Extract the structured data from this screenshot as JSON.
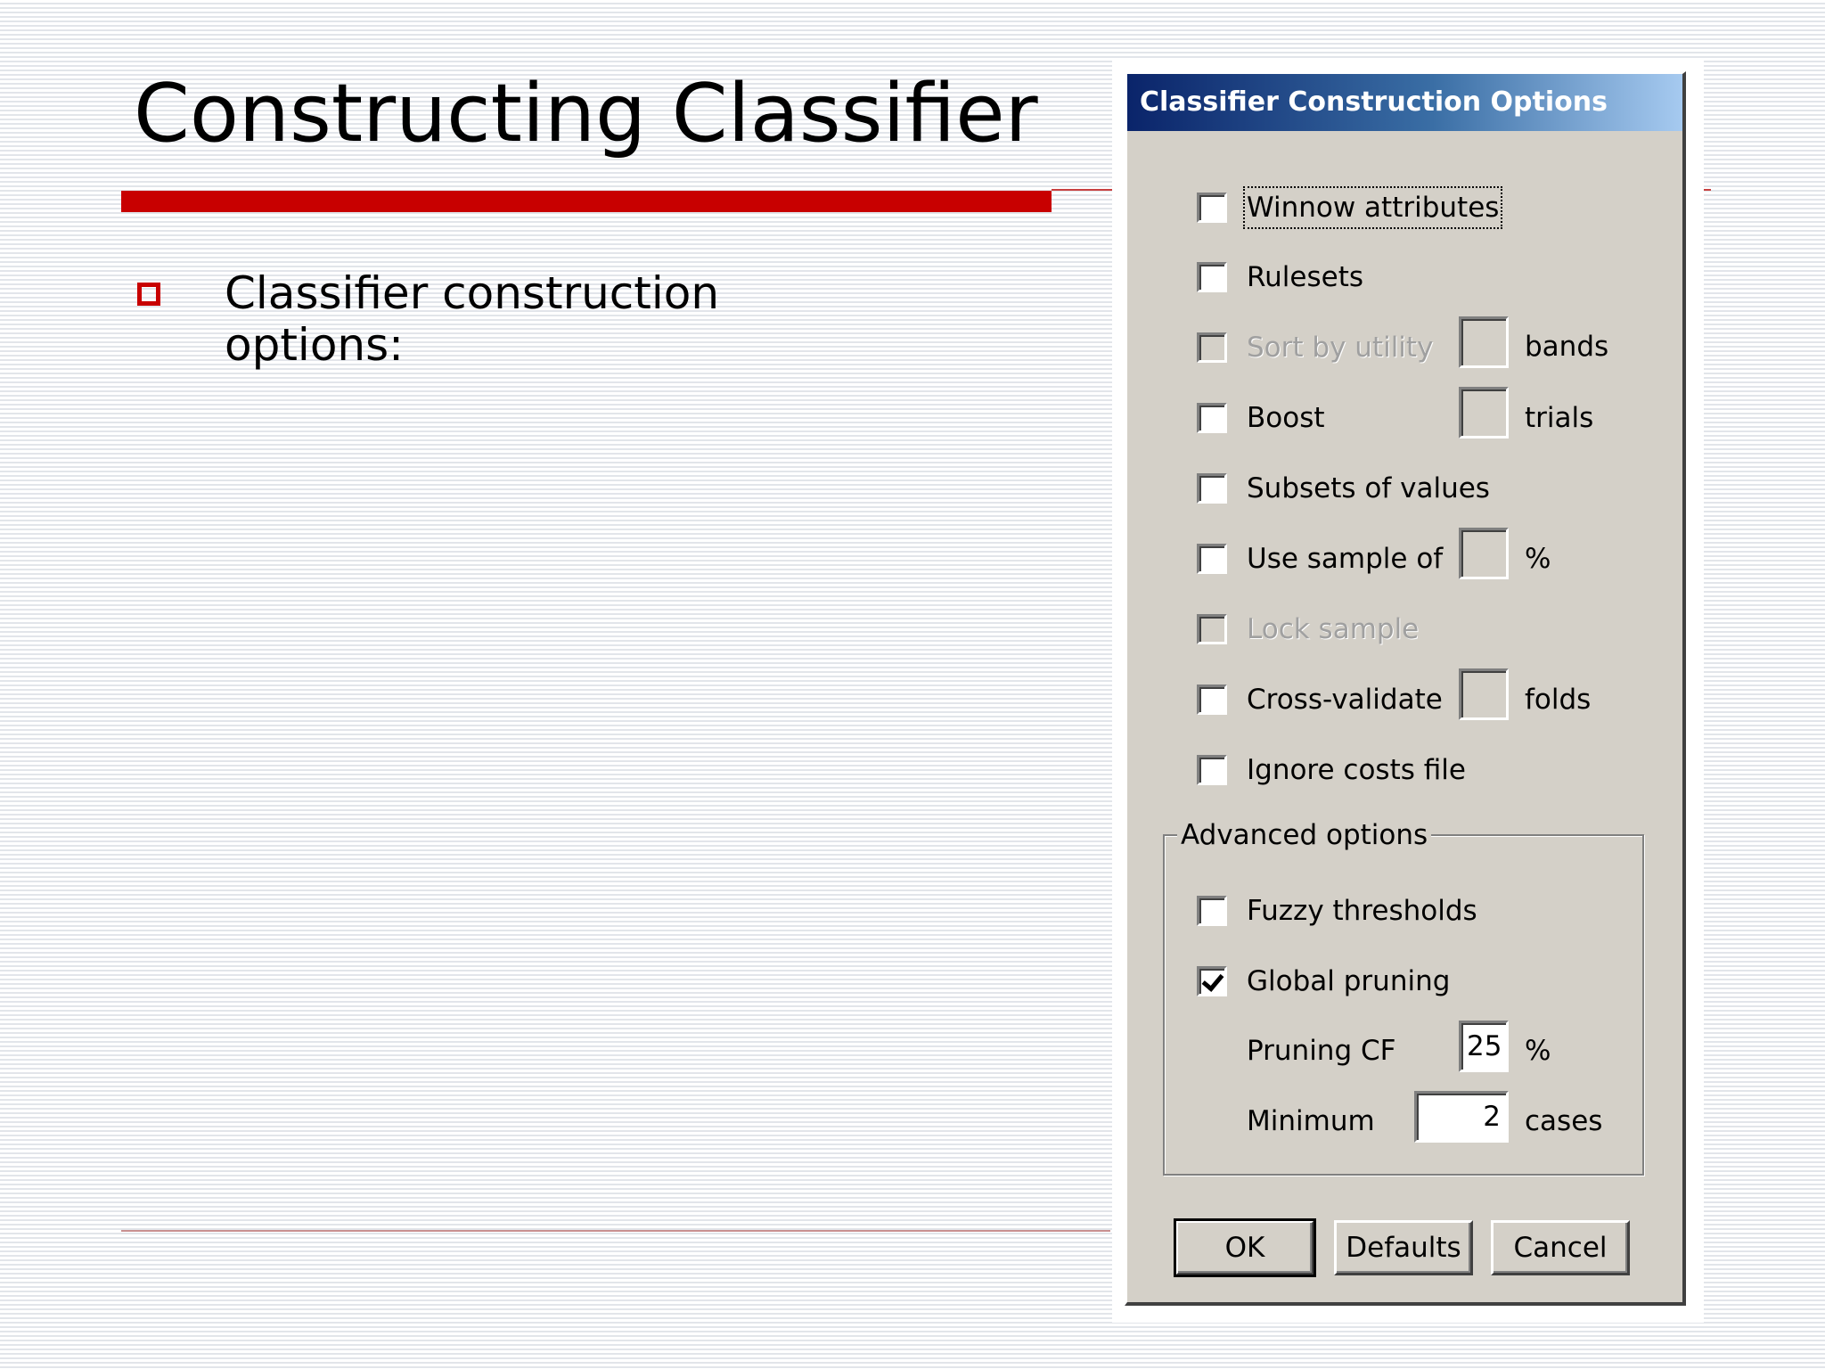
{
  "slide": {
    "title": "Constructing Classifier",
    "bullet_text": "Classifier construction options:"
  },
  "dialog": {
    "title": "Classifier Construction Options",
    "options": {
      "winnow": {
        "label": "Winnow attributes",
        "checked": false,
        "enabled": true
      },
      "rulesets": {
        "label": "Rulesets",
        "checked": false,
        "enabled": true
      },
      "sort_by_utility": {
        "label": "Sort by utility",
        "checked": false,
        "enabled": false,
        "value": "",
        "unit": "bands"
      },
      "boost": {
        "label": "Boost",
        "checked": false,
        "enabled": true,
        "value": "",
        "unit": "trials"
      },
      "subsets": {
        "label": "Subsets of values",
        "checked": false,
        "enabled": true
      },
      "use_sample": {
        "label": "Use sample of",
        "checked": false,
        "enabled": true,
        "value": "",
        "unit": "%"
      },
      "lock_sample": {
        "label": "Lock sample",
        "checked": false,
        "enabled": false
      },
      "cross_validate": {
        "label": "Cross-validate",
        "checked": false,
        "enabled": true,
        "value": "",
        "unit": "folds"
      },
      "ignore_costs": {
        "label": "Ignore costs file",
        "checked": false,
        "enabled": true
      }
    },
    "advanced": {
      "legend": "Advanced options",
      "fuzzy": {
        "label": "Fuzzy thresholds",
        "checked": false
      },
      "global_pruning": {
        "label": "Global pruning",
        "checked": true
      },
      "pruning_cf": {
        "label": "Pruning CF",
        "value": "25",
        "unit": "%"
      },
      "minimum": {
        "label": "Minimum",
        "value": "2",
        "unit": "cases"
      }
    },
    "buttons": {
      "ok": "OK",
      "defaults": "Defaults",
      "cancel": "Cancel"
    }
  },
  "colors": {
    "accent_red": "#c80000",
    "dialog_face": "#d4d0c8",
    "titlebar_start": "#0a246a",
    "titlebar_end": "#a6caf0"
  }
}
